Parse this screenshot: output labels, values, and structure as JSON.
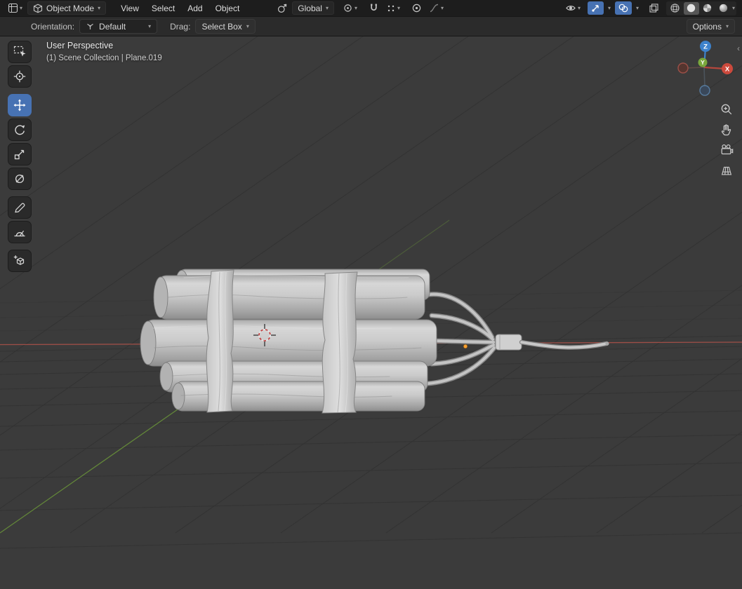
{
  "header": {
    "mode": "Object Mode",
    "menus": [
      "View",
      "Select",
      "Add",
      "Object"
    ],
    "transform_orientation": "Global"
  },
  "tool_settings": {
    "orientation_label": "Orientation:",
    "orientation_value": "Default",
    "drag_label": "Drag:",
    "drag_value": "Select Box",
    "options": "Options"
  },
  "viewport": {
    "view_label": "User Perspective",
    "breadcrumb": "(1) Scene Collection | Plane.019",
    "gizmo": {
      "x": "X",
      "y": "Y",
      "z": "Z"
    },
    "model": "dynamite-bundle"
  },
  "tools": {
    "active": "move",
    "items": [
      "select-box",
      "cursor",
      "move",
      "rotate",
      "scale",
      "transform",
      "annotate",
      "measure",
      "add-cube"
    ]
  },
  "colors": {
    "header_bg": "#1d1d1d",
    "tool_settings_bg": "#2b2b2b",
    "viewport_bg": "#3b3b3b",
    "accent": "#4772b3",
    "axis_x": "#b0524a",
    "axis_y": "#6d9b39",
    "origin_selected": "#ffa12e",
    "gizmo_x": "#cc4a3d",
    "gizmo_y": "#7aa83c",
    "gizmo_z": "#3d82cc"
  }
}
